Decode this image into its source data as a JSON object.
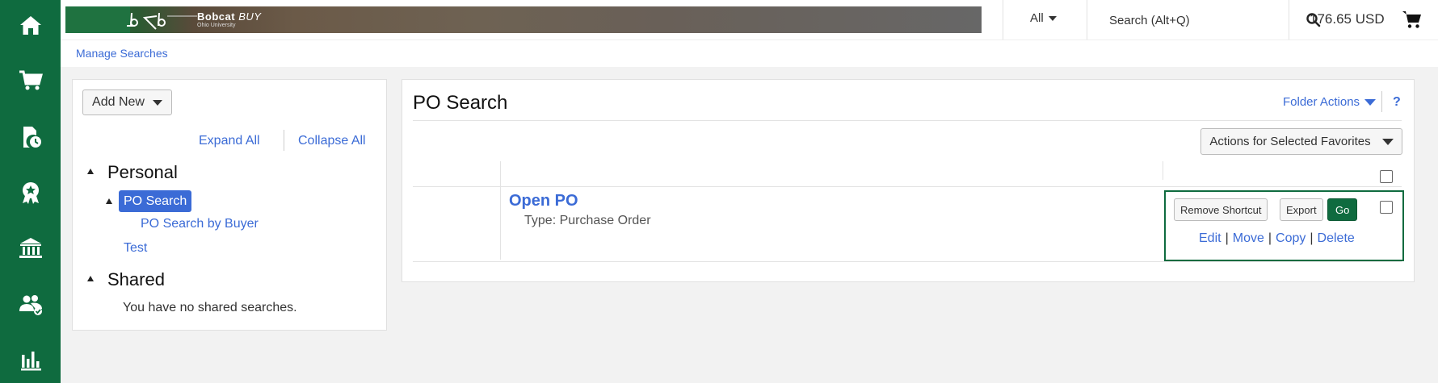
{
  "header": {
    "brand": "Bobcat",
    "brand_suffix": "BUY",
    "brand_sub": "Ohio University",
    "scope": "All",
    "search_placeholder": "Search (Alt+Q)",
    "cart_total": "176.65 USD"
  },
  "sidebar": {
    "icons": [
      "home-icon",
      "cart-icon",
      "document-clock-icon",
      "award-icon",
      "bank-icon",
      "users-icon",
      "bar-chart-icon"
    ]
  },
  "breadcrumb": {
    "link": "Manage Searches"
  },
  "left_panel": {
    "add_new": "Add New",
    "expand_all": "Expand All",
    "collapse_all": "Collapse All",
    "personal": "Personal",
    "selected": "PO Search",
    "child": "PO Search by Buyer",
    "test": "Test",
    "shared": "Shared",
    "shared_note": "You have no shared searches."
  },
  "right_panel": {
    "title": "PO Search",
    "folder_actions": "Folder Actions",
    "help": "?",
    "actions_selected": "Actions for Selected Favorites",
    "result": {
      "title": "Open PO",
      "type": "Type: Purchase Order",
      "remove_shortcut": "Remove Shortcut",
      "export": "Export",
      "go": "Go",
      "edit": "Edit",
      "move": "Move",
      "copy": "Copy",
      "delete": "Delete"
    }
  },
  "colors": {
    "brand_green": "#0f6b3f",
    "link_blue": "#3b6bd6"
  }
}
